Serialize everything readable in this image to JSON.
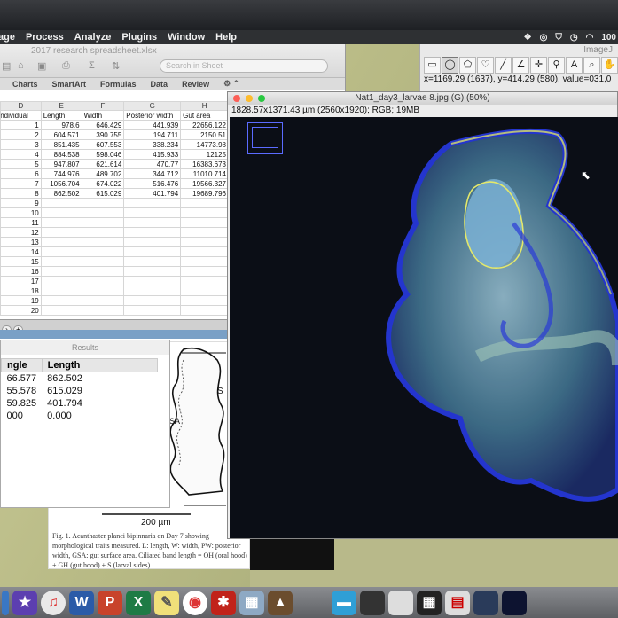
{
  "menubar": {
    "items": [
      "age",
      "Process",
      "Analyze",
      "Plugins",
      "Window",
      "Help"
    ],
    "battery": "100"
  },
  "excel": {
    "title": "2017 research spreadsheet.xlsx",
    "search_placeholder": "Search in Sheet",
    "tabs": [
      "Charts",
      "SmartArt",
      "Formulas",
      "Data",
      "Review"
    ],
    "columns": [
      "D",
      "E",
      "F",
      "G",
      "H"
    ],
    "headers": [
      "Individual",
      "Length",
      "Width",
      "Posterior width",
      "Gut area"
    ],
    "rows": [
      {
        "n": "1",
        "length": "978.6",
        "width": "646.429",
        "pw": "441.939",
        "gut": "22656.122"
      },
      {
        "n": "2",
        "length": "604.571",
        "width": "390.755",
        "pw": "194.711",
        "gut": "2150.51"
      },
      {
        "n": "3",
        "length": "851.435",
        "width": "607.553",
        "pw": "338.234",
        "gut": "14773.98"
      },
      {
        "n": "4",
        "length": "884.538",
        "width": "598.046",
        "pw": "415.933",
        "gut": "12125"
      },
      {
        "n": "5",
        "length": "947.807",
        "width": "621.614",
        "pw": "470.77",
        "gut": "16383.673"
      },
      {
        "n": "6",
        "length": "744.976",
        "width": "489.702",
        "pw": "344.712",
        "gut": "11010.714"
      },
      {
        "n": "7",
        "length": "1056.704",
        "width": "674.022",
        "pw": "516.476",
        "gut": "19566.327"
      },
      {
        "n": "8",
        "length": "862.502",
        "width": "615.029",
        "pw": "401.794",
        "gut": "19689.796"
      }
    ],
    "empty_rows": [
      "9",
      "10",
      "11",
      "12",
      "13",
      "14",
      "15",
      "16",
      "17",
      "18",
      "19",
      "20"
    ]
  },
  "results": {
    "title": "Results",
    "col_angle": "ngle",
    "col_length": "Length",
    "rows": [
      {
        "angle": "66.577",
        "length": "862.502"
      },
      {
        "angle": "55.578",
        "length": "615.029"
      },
      {
        "angle": "59.825",
        "length": "401.794"
      },
      {
        "angle": "000",
        "length": "0.000"
      }
    ]
  },
  "paper": {
    "scale_label": "200 µm",
    "label_sa": "SA",
    "label_s": "S",
    "caption": "Fig. 1. Acanthaster planci bipinnaria on Day 7 showing morphological traits measured. L: length, W: width, PW: posterior width, GSA: gut surface area. Ciliated band length = OH (oral hood) + GH (gut hood) + S (larval sides)"
  },
  "imagej": {
    "title": "ImageJ",
    "status": "x=1169.29 (1637), y=414.29 (580), value=031,0",
    "tools": [
      "rect",
      "oval",
      "poly",
      "free",
      "line",
      "angle",
      "point",
      "wand",
      "text",
      "zoom",
      "hand"
    ]
  },
  "image_window": {
    "title": "Nat1_day3_larvae 8.jpg (G) (50%)",
    "info": "1828.57x1371.43 µm (2560x1920); RGB; 19MB"
  },
  "dock": {
    "apps": [
      "finder",
      "imovie",
      "itunes",
      "word",
      "powerpoint",
      "excel",
      "stickies",
      "chrome",
      "acrobat",
      "preview",
      "photo"
    ]
  },
  "colors": {
    "menubar": "#2e3033",
    "excel_status": "#7aa0c6",
    "zoom_box": "#5b6bff",
    "selection": "#e4e86a"
  }
}
